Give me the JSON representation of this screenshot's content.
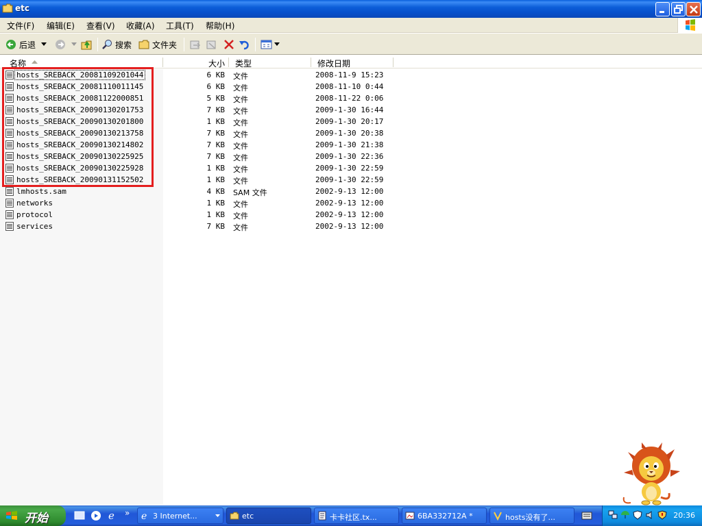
{
  "window": {
    "title": "etc"
  },
  "menubar": [
    "文件(F)",
    "编辑(E)",
    "查看(V)",
    "收藏(A)",
    "工具(T)",
    "帮助(H)"
  ],
  "toolbar": {
    "back": "后退",
    "search": "搜索",
    "folders": "文件夹"
  },
  "columns": {
    "name": "名称",
    "size": "大小",
    "type": "类型",
    "date": "修改日期"
  },
  "files": [
    {
      "name": "hosts_SREBACK_20081109201044",
      "size": "6 KB",
      "type": "文件",
      "date": "2008-11-9 15:23"
    },
    {
      "name": "hosts_SREBACK_20081110011145",
      "size": "6 KB",
      "type": "文件",
      "date": "2008-11-10 0:44"
    },
    {
      "name": "hosts_SREBACK_20081122000851",
      "size": "5 KB",
      "type": "文件",
      "date": "2008-11-22 0:06"
    },
    {
      "name": "hosts_SREBACK_20090130201753",
      "size": "7 KB",
      "type": "文件",
      "date": "2009-1-30 16:44"
    },
    {
      "name": "hosts_SREBACK_20090130201800",
      "size": "1 KB",
      "type": "文件",
      "date": "2009-1-30 20:17"
    },
    {
      "name": "hosts_SREBACK_20090130213758",
      "size": "7 KB",
      "type": "文件",
      "date": "2009-1-30 20:38"
    },
    {
      "name": "hosts_SREBACK_20090130214802",
      "size": "7 KB",
      "type": "文件",
      "date": "2009-1-30 21:38"
    },
    {
      "name": "hosts_SREBACK_20090130225925",
      "size": "7 KB",
      "type": "文件",
      "date": "2009-1-30 22:36"
    },
    {
      "name": "hosts_SREBACK_20090130225928",
      "size": "1 KB",
      "type": "文件",
      "date": "2009-1-30 22:59"
    },
    {
      "name": "hosts_SREBACK_20090131152502",
      "size": "1 KB",
      "type": "文件",
      "date": "2009-1-30 22:59"
    },
    {
      "name": "lmhosts.sam",
      "size": "4 KB",
      "type": "SAM 文件",
      "date": "2002-9-13 12:00"
    },
    {
      "name": "networks",
      "size": "1 KB",
      "type": "文件",
      "date": "2002-9-13 12:00"
    },
    {
      "name": "protocol",
      "size": "1 KB",
      "type": "文件",
      "date": "2002-9-13 12:00"
    },
    {
      "name": "services",
      "size": "7 KB",
      "type": "文件",
      "date": "2002-9-13 12:00"
    }
  ],
  "taskbar": {
    "start": "开始",
    "tasks": [
      "3 Internet...",
      "etc",
      "卡卡社区.tx...",
      "6BA332712A *",
      "hosts没有了..."
    ],
    "clock": "20:36"
  },
  "colors": {
    "highlight": "#e41e1e",
    "titlebar": "#0a5fdc",
    "taskbar": "#245edc",
    "start": "#3c8f3c"
  }
}
